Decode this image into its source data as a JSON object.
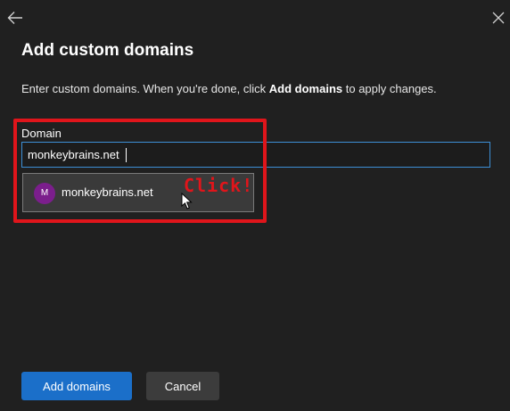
{
  "header": {
    "back_icon": "arrow-left-icon",
    "close_icon": "close-icon"
  },
  "panel": {
    "title": "Add custom domains",
    "description_prefix": "Enter custom domains. When you're done, click ",
    "description_bold": "Add domains",
    "description_suffix": " to apply changes."
  },
  "domain_field": {
    "label": "Domain",
    "value": "monkeybrains.net"
  },
  "suggestion": {
    "avatar_letter": "M",
    "label": "monkeybrains.net"
  },
  "annotation": {
    "text": "Click!",
    "color": "#e0151b"
  },
  "footer": {
    "primary_label": "Add domains",
    "secondary_label": "Cancel"
  },
  "colors": {
    "background": "#202020",
    "accent": "#1b6fc9",
    "input_focus_border": "#3d8fd6",
    "avatar": "#7b1e8c"
  }
}
